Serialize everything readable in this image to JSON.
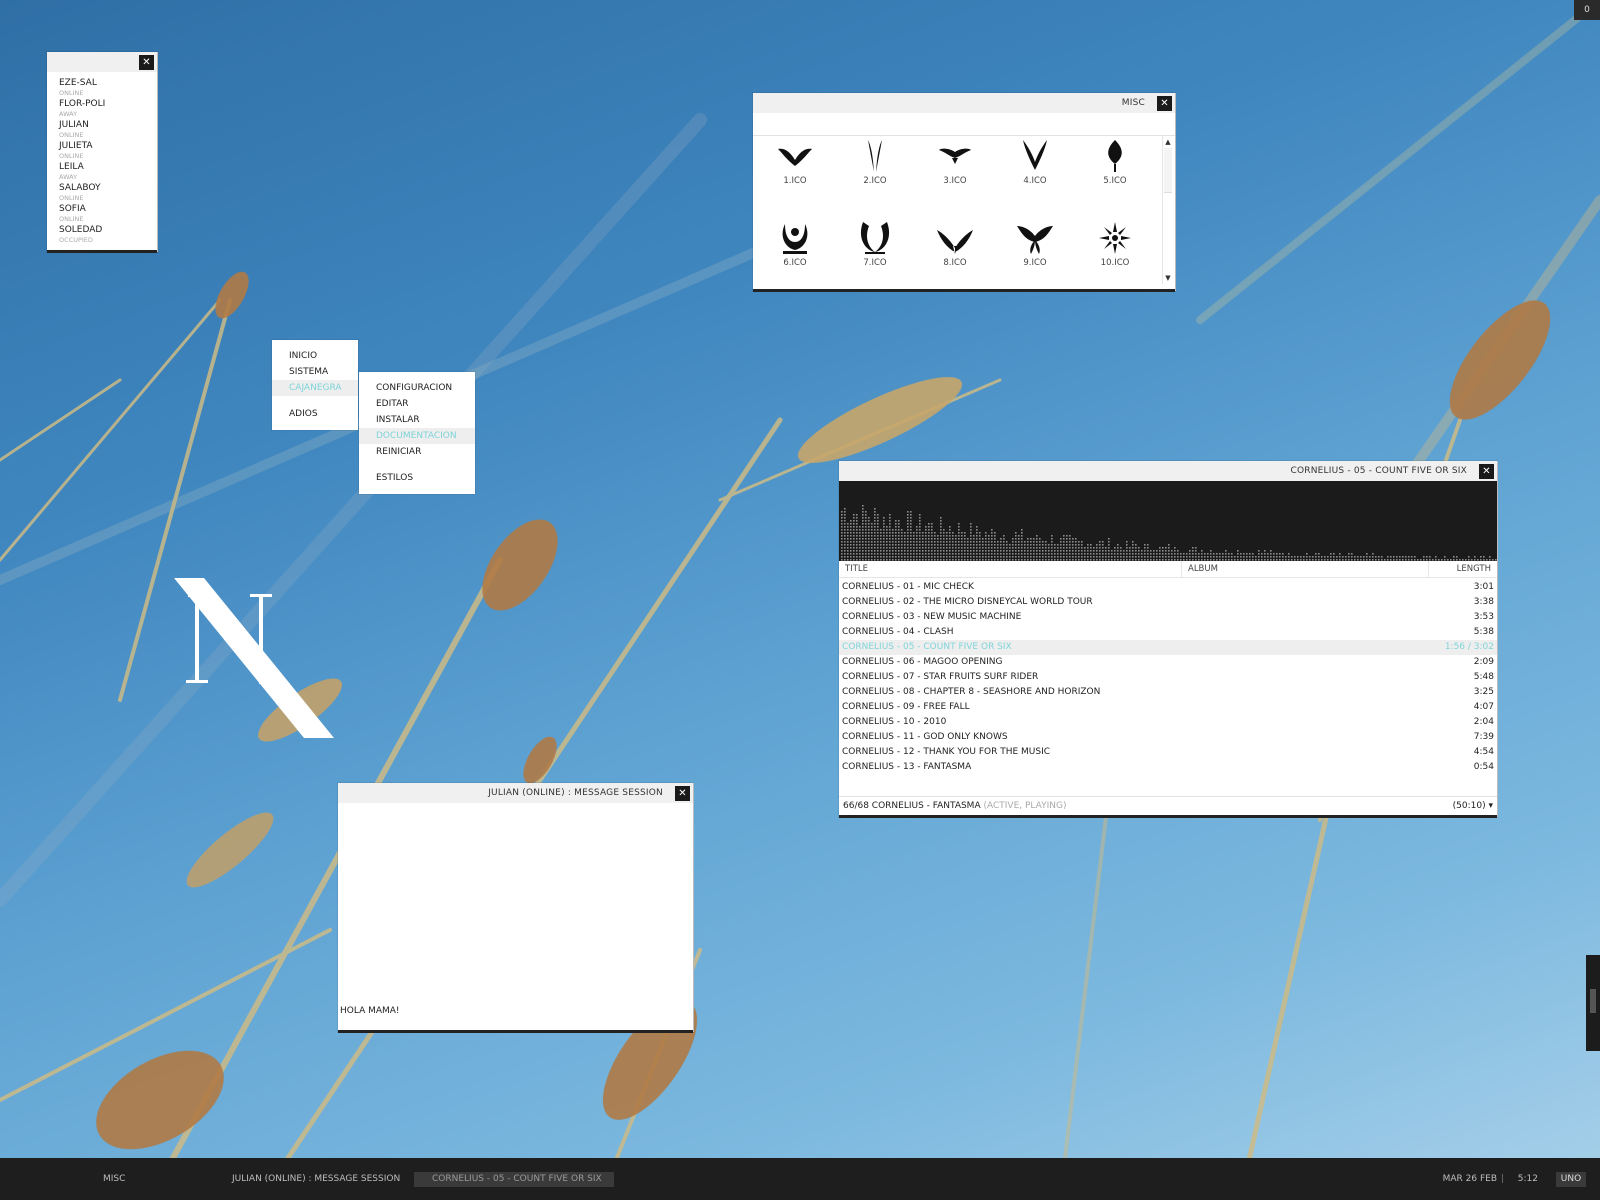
{
  "desktop": {
    "corner_badge": "0",
    "logo_letter": "N"
  },
  "contacts": {
    "items": [
      {
        "name": "EZE-SAL",
        "status": "ONLINE"
      },
      {
        "name": "FLOR-POLI",
        "status": "AWAY"
      },
      {
        "name": "JULIAN",
        "status": "ONLINE"
      },
      {
        "name": "JULIETA",
        "status": "ONLINE"
      },
      {
        "name": "LEILA",
        "status": "AWAY"
      },
      {
        "name": "SALABOY",
        "status": "ONLINE"
      },
      {
        "name": "SOFIA",
        "status": "ONLINE"
      },
      {
        "name": "SOLEDAD",
        "status": "OCCUPIED"
      }
    ]
  },
  "menu": {
    "main": [
      "INICIO",
      "SISTEMA",
      "CAJANEGRA",
      "ADIOS"
    ],
    "sub": [
      "CONFIGURACION",
      "EDITAR",
      "INSTALAR",
      "DOCUMENTACION",
      "REINICIAR",
      "ESTILOS"
    ]
  },
  "misc": {
    "title": "MISC",
    "icons": [
      "1.ICO",
      "2.ICO",
      "3.ICO",
      "4.ICO",
      "5.ICO",
      "6.ICO",
      "7.ICO",
      "8.ICO",
      "9.ICO",
      "10.ICO"
    ]
  },
  "player": {
    "title": "CORNELIUS - 05 - COUNT FIVE OR SIX",
    "columns": {
      "title": "TITLE",
      "album": "ALBUM",
      "length": "LENGTH"
    },
    "tracks": [
      {
        "title": "CORNELIUS - 01 - MIC CHECK",
        "length": "3:01"
      },
      {
        "title": "CORNELIUS - 02 - THE MICRO DISNEYCAL WORLD TOUR",
        "length": "3:38"
      },
      {
        "title": "CORNELIUS - 03 - NEW MUSIC MACHINE",
        "length": "3:53"
      },
      {
        "title": "CORNELIUS - 04 - CLASH",
        "length": "5:38"
      },
      {
        "title": "CORNELIUS - 05 - COUNT FIVE OR SIX",
        "length": "1:56 / 3:02"
      },
      {
        "title": "CORNELIUS - 06 - MAGOO OPENING",
        "length": "2:09"
      },
      {
        "title": "CORNELIUS - 07 - STAR FRUITS SURF RIDER",
        "length": "5:48"
      },
      {
        "title": "CORNELIUS - 08 - CHAPTER 8 - SEASHORE AND HORIZON",
        "length": "3:25"
      },
      {
        "title": "CORNELIUS - 09 - FREE FALL",
        "length": "4:07"
      },
      {
        "title": "CORNELIUS - 10 - 2010",
        "length": "2:04"
      },
      {
        "title": "CORNELIUS - 11 - GOD ONLY KNOWS",
        "length": "7:39"
      },
      {
        "title": "CORNELIUS - 12 - THANK YOU FOR THE MUSIC",
        "length": "4:54"
      },
      {
        "title": "CORNELIUS - 13 - FANTASMA",
        "length": "0:54"
      }
    ],
    "status_main": "66/68 CORNELIUS - FANTASMA",
    "status_state": "(ACTIVE, PLAYING)",
    "status_total": "(50:10)",
    "dropdown_glyph": "▾"
  },
  "message": {
    "title": "JULIAN (ONLINE) : MESSAGE SESSION",
    "text": "HOLA MAMA!"
  },
  "taskbar": {
    "tasks": [
      "MISC",
      "JULIAN (ONLINE) : MESSAGE SESSION",
      "CORNELIUS - 05 - COUNT FIVE OR SIX"
    ],
    "date": "MAR 26 FEB",
    "separator": "|",
    "time": "5:12",
    "workspace": "UNO"
  },
  "colors": {
    "accent": "#7fd4d9",
    "window_bg": "#ffffff",
    "titlebar_bg": "#f0f0f0",
    "taskbar_bg": "#1e1e1e",
    "visualizer_bg": "#1b1b1b"
  }
}
